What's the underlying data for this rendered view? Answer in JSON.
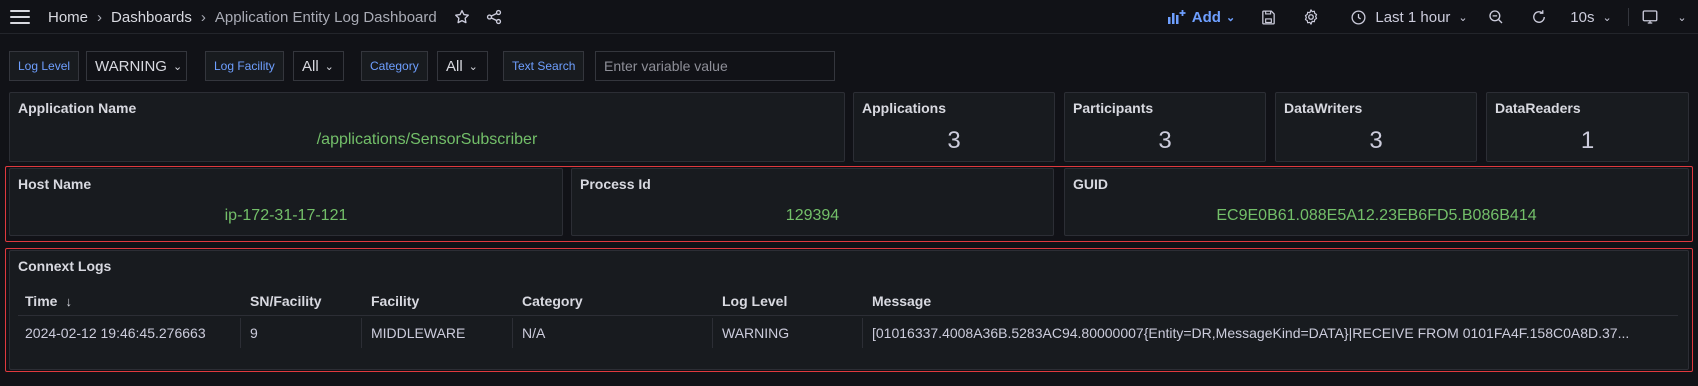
{
  "breadcrumbs": [
    "Home",
    "Dashboards",
    "Application Entity Log Dashboard"
  ],
  "toolbar": {
    "add_label": "Add",
    "time_range": "Last 1 hour",
    "refresh_interval": "10s",
    "accent_color": "#6e9fff"
  },
  "variables": {
    "log_level": {
      "label": "Log Level",
      "value": "WARNING"
    },
    "log_facility": {
      "label": "Log Facility",
      "value": "All"
    },
    "category": {
      "label": "Category",
      "value": "All"
    },
    "text_search": {
      "label": "Text Search",
      "placeholder": "Enter variable value"
    }
  },
  "panels": {
    "application_name": {
      "title": "Application Name",
      "value": "/applications/SensorSubscriber"
    },
    "applications": {
      "title": "Applications",
      "value": "3"
    },
    "participants": {
      "title": "Participants",
      "value": "3"
    },
    "datawriters": {
      "title": "DataWriters",
      "value": "3"
    },
    "datareaders": {
      "title": "DataReaders",
      "value": "1"
    },
    "host_name": {
      "title": "Host Name",
      "value": "ip-172-31-17-121"
    },
    "process_id": {
      "title": "Process Id",
      "value": "129394"
    },
    "guid": {
      "title": "GUID",
      "value": "EC9E0B61.088E5A12.23EB6FD5.B086B414"
    }
  },
  "logs": {
    "title": "Connext Logs",
    "columns": [
      "Time",
      "SN/Facility",
      "Facility",
      "Category",
      "Log Level",
      "Message"
    ],
    "rows": [
      [
        "2024-02-12 19:46:45.276663",
        "9",
        "MIDDLEWARE",
        "N/A",
        "WARNING",
        "[01016337.4008A36B.5283AC94.80000007{Entity=DR,MessageKind=DATA}|RECEIVE FROM 0101FA4F.158C0A8D.37..."
      ]
    ]
  },
  "colors": {
    "value_green": "#73bf69",
    "highlight_red": "#e0393e",
    "background": "#111217",
    "panel": "#181b1f"
  }
}
